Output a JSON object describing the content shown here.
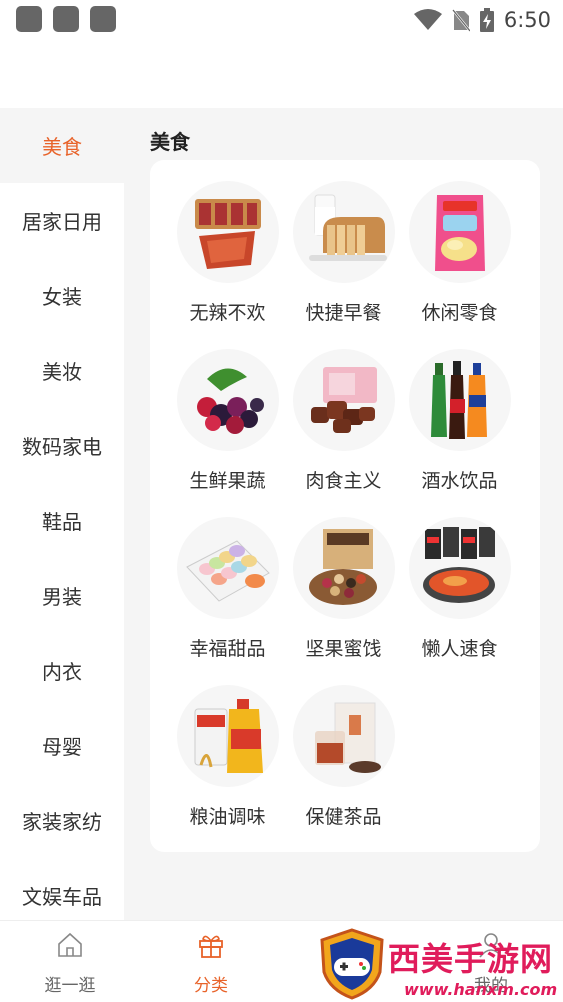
{
  "status_bar": {
    "time": "6:50",
    "icons": [
      "app-square-icon",
      "app-square-icon",
      "app-square-icon",
      "wifi-icon",
      "no-sim-icon",
      "battery-charging-icon"
    ]
  },
  "sidebar": {
    "items": [
      {
        "label": "美食",
        "active": true
      },
      {
        "label": "居家日用"
      },
      {
        "label": "女装"
      },
      {
        "label": "美妆"
      },
      {
        "label": "数码家电"
      },
      {
        "label": "鞋品"
      },
      {
        "label": "男装"
      },
      {
        "label": "内衣"
      },
      {
        "label": "母婴"
      },
      {
        "label": "家装家纺"
      },
      {
        "label": "文娱车品"
      }
    ]
  },
  "main": {
    "section_title": "美食",
    "categories": [
      {
        "label": "无辣不欢",
        "icon": "spicy-jerky-icon"
      },
      {
        "label": "快捷早餐",
        "icon": "bread-milk-icon"
      },
      {
        "label": "休闲零食",
        "icon": "chips-bag-icon"
      },
      {
        "label": "生鲜果蔬",
        "icon": "berries-icon"
      },
      {
        "label": "肉食主义",
        "icon": "beef-cubes-icon"
      },
      {
        "label": "酒水饮品",
        "icon": "soda-bottles-icon"
      },
      {
        "label": "幸福甜品",
        "icon": "macarons-icon"
      },
      {
        "label": "坚果蜜饯",
        "icon": "nuts-icon"
      },
      {
        "label": "懒人速食",
        "icon": "instant-noodles-icon"
      },
      {
        "label": "粮油调味",
        "icon": "rice-oil-icon"
      },
      {
        "label": "保健茶品",
        "icon": "herbal-tea-icon"
      }
    ]
  },
  "bottom_nav": {
    "items": [
      {
        "label": "逛一逛",
        "icon": "home-icon"
      },
      {
        "label": "分类",
        "icon": "gift-icon",
        "active": true
      },
      {
        "label": "我的",
        "icon": "user-icon"
      }
    ]
  },
  "watermark": {
    "text": "西美手游网",
    "url": "www.hanxm.com"
  },
  "colors": {
    "accent": "#e8632a",
    "main_bg": "#f5f5f5",
    "watermark": "#e01c5b"
  }
}
